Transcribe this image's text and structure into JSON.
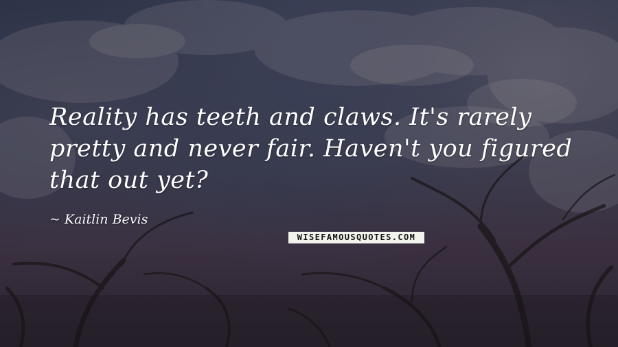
{
  "quote": {
    "text": "Reality has teeth and claws. It's rarely pretty and never fair. Haven't you figured that out yet?"
  },
  "author": {
    "dash": "~",
    "name": "Kaitlin Bevis"
  },
  "watermark": {
    "text": "WISEFAMOUSQUOTES.COM"
  },
  "colors": {
    "text": "#ffffff",
    "sky_top": "#2c3347",
    "sky_bottom": "#2a2430",
    "watermark_bg": "#f3f3ee"
  }
}
